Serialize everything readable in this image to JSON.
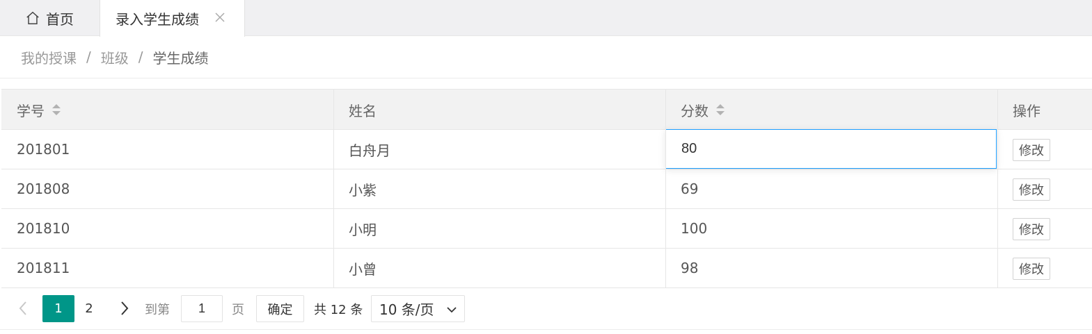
{
  "tabs": {
    "home_label": "首页",
    "active_label": "录入学生成绩"
  },
  "breadcrumb": {
    "items": [
      "我的授课",
      "班级",
      "学生成绩"
    ],
    "separator": "/"
  },
  "table": {
    "columns": [
      "学号",
      "姓名",
      "分数",
      "操作"
    ],
    "rows": [
      {
        "id": "201801",
        "name": "白舟月",
        "score": "80",
        "action": "修改"
      },
      {
        "id": "201808",
        "name": "小紫",
        "score": "69",
        "action": "修改"
      },
      {
        "id": "201810",
        "name": "小明",
        "score": "100",
        "action": "修改"
      },
      {
        "id": "201811",
        "name": "小曾",
        "score": "98",
        "action": "修改"
      }
    ]
  },
  "pagination": {
    "pages": [
      "1",
      "2"
    ],
    "current_page": "1",
    "goto_label": "到第",
    "goto_value": "1",
    "page_unit": "页",
    "confirm_label": "确定",
    "total_label": "共 12 条",
    "page_size_label": "10 条/页"
  },
  "colors": {
    "accent": "#009688",
    "focus_border": "#1e9fff",
    "header_bg": "#f2f2f2"
  }
}
